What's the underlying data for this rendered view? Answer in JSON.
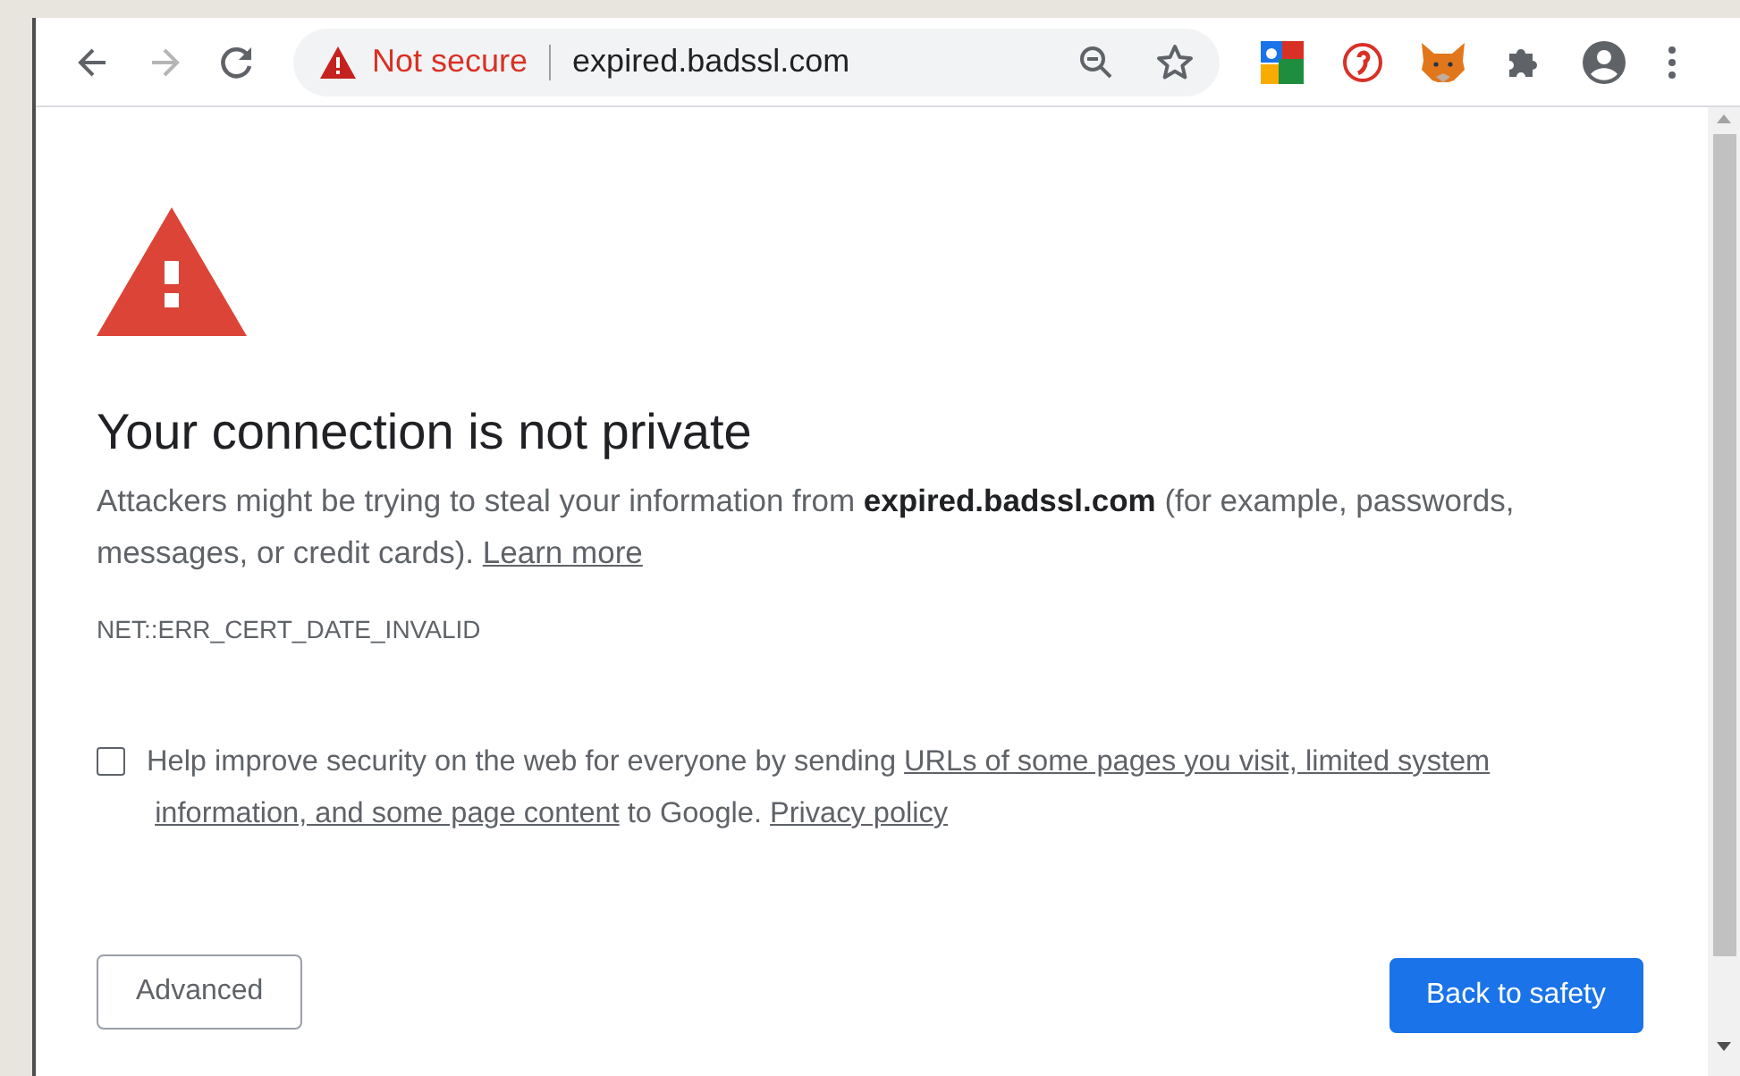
{
  "toolbar": {
    "back": {
      "disabled": false
    },
    "forward": {
      "disabled": true
    },
    "omnibox": {
      "security_label": "Not secure",
      "url": "expired.badssl.com"
    }
  },
  "page": {
    "heading": "Your connection is not private",
    "paragraph": [
      {
        "kind": "text",
        "text": "Attackers might be trying to steal your information from **expired.badssl.com** (for example, passwords, messages, or credit cards). "
      },
      {
        "kind": "link",
        "text": "Learn more"
      }
    ],
    "error_code": "NET::ERR_CERT_DATE_INVALID",
    "consent": {
      "checked": false,
      "segments": [
        {
          "kind": "text",
          "text": "Help improve security on the web for everyone by sending "
        },
        {
          "kind": "link",
          "text": "URLs of some pages you visit, limited system"
        },
        {
          "kind": "link",
          "text": "information, and some page content"
        },
        {
          "kind": "text",
          "text": " to Google. "
        },
        {
          "kind": "link",
          "text": "Privacy policy"
        }
      ]
    },
    "buttons": [
      {
        "label": "Advanced",
        "kind": "secondary"
      },
      {
        "label": "Back to safety",
        "kind": "primary"
      }
    ]
  }
}
